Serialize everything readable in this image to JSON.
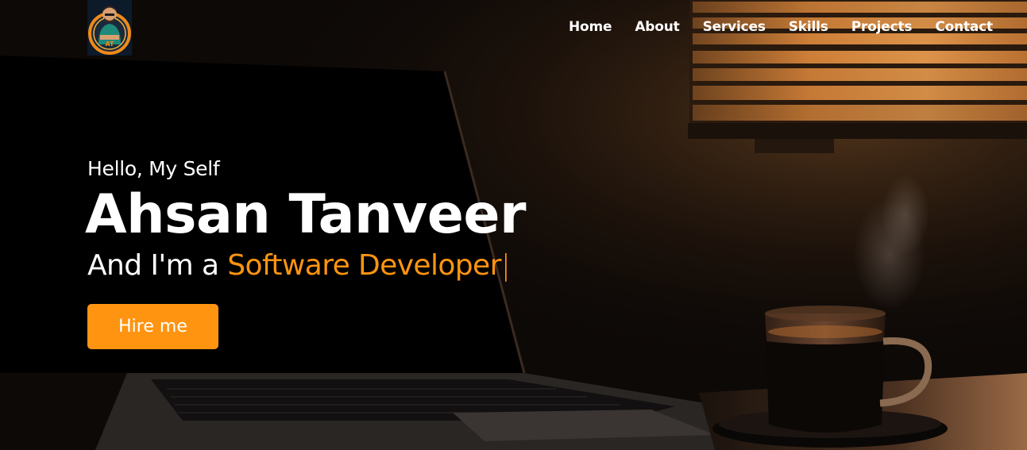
{
  "nav": {
    "items": [
      {
        "label": "Home"
      },
      {
        "label": "About"
      },
      {
        "label": "Services"
      },
      {
        "label": "Skills"
      },
      {
        "label": "Projects"
      },
      {
        "label": "Contact"
      }
    ]
  },
  "hero": {
    "greeting": "Hello, My Self",
    "name": "Ahsan Tanveer",
    "role_prefix": "And I'm a",
    "role": "Software Developer",
    "cursor": "|",
    "button_label": "Hire me"
  },
  "colors": {
    "accent": "#ff9410",
    "text": "#ffffff",
    "background": "#0b0806"
  },
  "icons": {
    "logo": "developer-avatar-logo"
  }
}
